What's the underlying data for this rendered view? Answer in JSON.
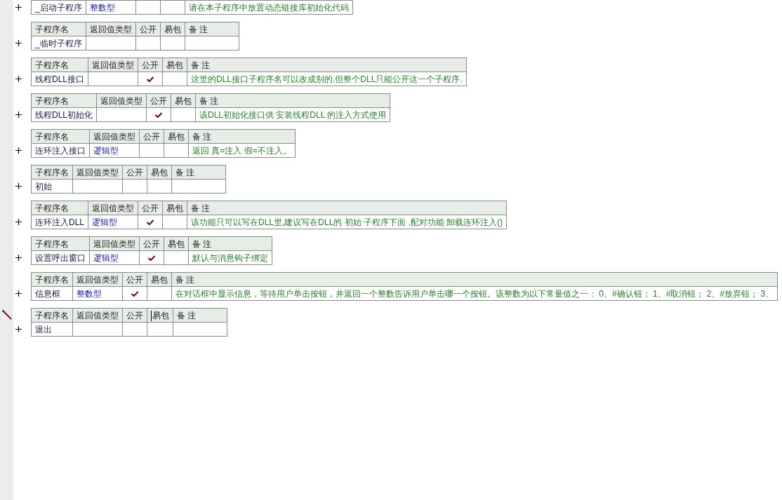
{
  "subprograms": [
    {
      "name": "_启动子程序",
      "return_type": "整数型",
      "public": false,
      "easy_pack": false,
      "remark": "请在本子程序中放置动态链接库初始化代码",
      "editing": false
    },
    {
      "columns": [
        "子程序名",
        "返回值类型",
        "公开",
        "易包",
        "备 注"
      ],
      "name": "_临时子程序",
      "public": false,
      "easy_pack": false,
      "editing": false
    },
    {
      "columns": [
        "子程序名",
        "返回值类型",
        "公开",
        "易包",
        "备 注"
      ],
      "name": "线程DLL接口",
      "public": true,
      "easy_pack": false,
      "remark": "这里的DLL接口子程序名可以改成别的.但整个DLL只能公开这一个子程序.",
      "editing": false
    },
    {
      "columns": [
        "子程序名",
        "返回值类型",
        "公开",
        "易包",
        "备 注"
      ],
      "name": "线程DLL初始化",
      "public": true,
      "easy_pack": false,
      "remark": "该DLL初始化接口供 安装线程DLL 的注入方式使用",
      "editing": false
    },
    {
      "columns": [
        "子程序名",
        "返回值类型",
        "公开",
        "易包",
        "备 注"
      ],
      "name": "连环注入接口",
      "return_type": "逻辑型",
      "public": false,
      "easy_pack": false,
      "remark": "返回 真=注入 假=不注入。",
      "editing": false
    },
    {
      "columns": [
        "子程序名",
        "返回值类型",
        "公开",
        "易包",
        "备 注"
      ],
      "name": "初始",
      "public": false,
      "easy_pack": false,
      "editing": false
    },
    {
      "columns": [
        "子程序名",
        "返回值类型",
        "公开",
        "易包",
        "备 注"
      ],
      "name": "连环注入DLL",
      "return_type": "逻辑型",
      "public": true,
      "easy_pack": false,
      "remark": "该功能只可以写在DLL里,建议写在DLL的 初始 子程序下面 .配对功能 卸载连环注入()",
      "editing": false
    },
    {
      "columns": [
        "子程序名",
        "返回值类型",
        "公开",
        "易包",
        "备 注"
      ],
      "name": "设置呼出窗口",
      "return_type": "逻辑型",
      "public": true,
      "easy_pack": false,
      "remark": "默认与消息钩子绑定",
      "editing": false
    },
    {
      "columns": [
        "子程序名",
        "返回值类型",
        "公开",
        "易包",
        "备 注"
      ],
      "name": "信息框",
      "return_type": "整数型",
      "public": true,
      "easy_pack": false,
      "remark": "在对话框中显示信息，等待用户单击按钮，并返回一个整数告诉用户单击哪一个按钮。该整数为以下常量值之一： 0、#确认钮； 1、#取消钮； 2、#放弃钮； 3、",
      "editing": false
    },
    {
      "columns": [
        "子程序名",
        "返回值类型",
        "公开",
        "易包",
        "备 注"
      ],
      "name": "退出",
      "public": false,
      "easy_pack": false,
      "editing": true
    }
  ]
}
